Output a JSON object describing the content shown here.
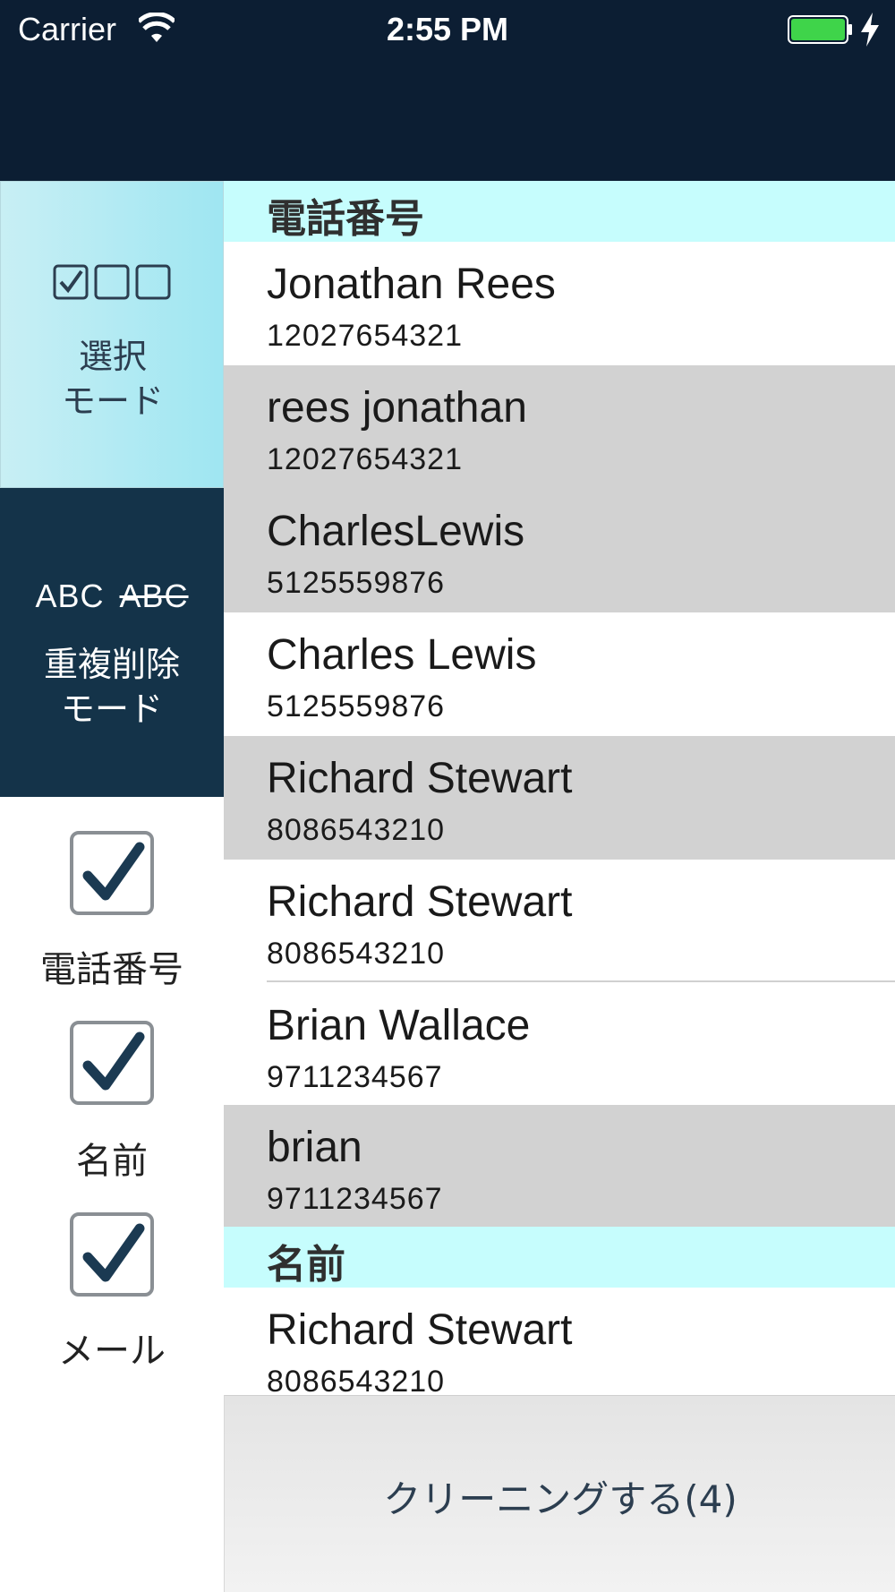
{
  "status_bar": {
    "carrier": "Carrier",
    "time": "2:55 PM",
    "battery_color": "#3fd44a"
  },
  "sidebar": {
    "select_mode": {
      "label_line1": "選択",
      "label_line2": "モード",
      "icon": "checkbox-triplet-icon"
    },
    "dedupe_mode": {
      "label_line1": "重複削除",
      "label_line2": "モード",
      "icon_text": "ABC",
      "icon_text_struck": "ABC"
    },
    "filters": [
      {
        "label": "電話番号",
        "checked": true
      },
      {
        "label": "名前",
        "checked": true
      },
      {
        "label": "メール",
        "checked": true
      }
    ]
  },
  "list": {
    "sections": [
      {
        "header": "電話番号",
        "rows": [
          {
            "name": "Jonathan Rees",
            "phone": "12027654321",
            "highlight": false
          },
          {
            "name": "rees jonathan",
            "phone": "12027654321",
            "highlight": true
          },
          {
            "name": "CharlesLewis",
            "phone": "5125559876",
            "highlight": true
          },
          {
            "name": "Charles Lewis",
            "phone": "5125559876",
            "highlight": false
          },
          {
            "name": "Richard Stewart",
            "phone": "8086543210",
            "highlight": true
          },
          {
            "name": "Richard Stewart",
            "phone": "8086543210",
            "highlight": false
          },
          {
            "name": "Brian Wallace",
            "phone": "9711234567",
            "highlight": false
          },
          {
            "name": "brian",
            "phone": "9711234567",
            "highlight": true
          }
        ]
      },
      {
        "header": "名前",
        "rows": [
          {
            "name": "Richard Stewart",
            "phone": "8086543210",
            "highlight": false
          }
        ]
      }
    ]
  },
  "clean_button": {
    "label": "クリーニングする(4)"
  },
  "colors": {
    "nav_dark": "#0c1e33",
    "dedupe_bg": "#143349",
    "section_header": "#c6fdfd",
    "highlight_row": "#d2d2d2",
    "check_mark": "#1b3a52"
  }
}
